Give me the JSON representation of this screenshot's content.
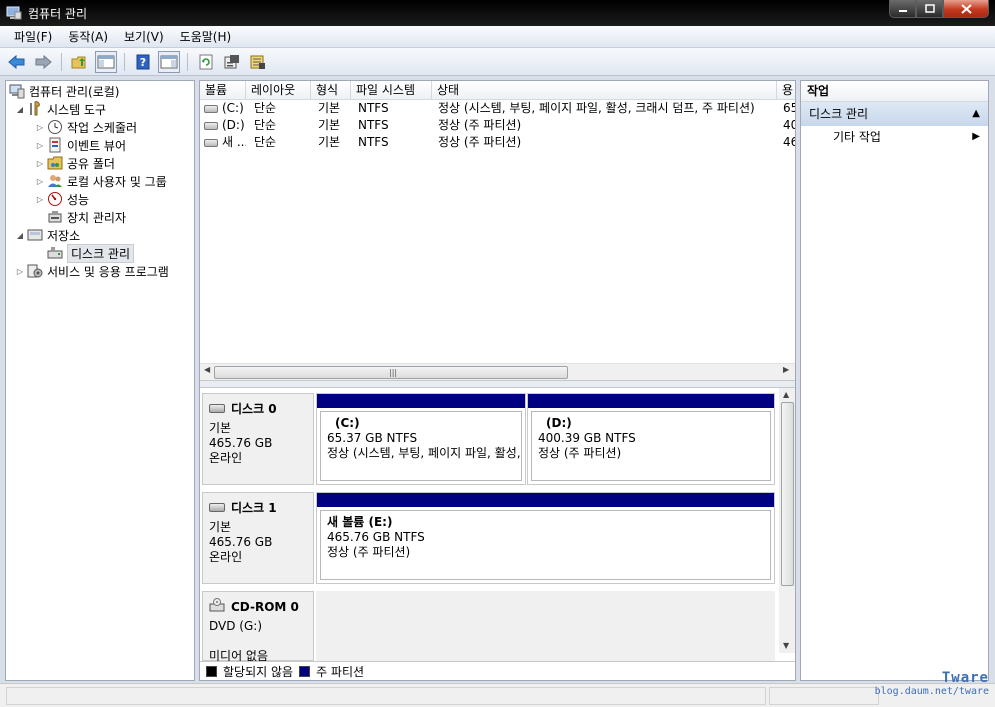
{
  "window": {
    "title": "컴퓨터 관리"
  },
  "menu": [
    "파일(F)",
    "동작(A)",
    "보기(V)",
    "도움말(H)"
  ],
  "toolbar": [
    "back-icon",
    "forward-icon",
    "up-folder-icon",
    "show-hide-tree-icon",
    "help-icon",
    "show-hide-action-pane-icon",
    "refresh-icon",
    "properties-icon",
    "export-icon"
  ],
  "tree": {
    "root": "컴퓨터 관리(로컬)",
    "system_tools": "시스템 도구",
    "task_scheduler": "작업 스케줄러",
    "event_viewer": "이벤트 뷰어",
    "shared_folders": "공유 폴더",
    "local_users": "로컬 사용자 및 그룹",
    "performance": "성능",
    "device_manager": "장치 관리자",
    "storage": "저장소",
    "disk_management": "디스크 관리",
    "services": "서비스 및 응용 프로그램"
  },
  "volume_list": {
    "columns": [
      "볼륨",
      "레이아웃",
      "형식",
      "파일 시스템",
      "상태",
      "용"
    ],
    "rows": [
      [
        "(C:)",
        "단순",
        "기본",
        "NTFS",
        "정상 (시스템, 부팅, 페이지 파일, 활성, 크래시 덤프, 주 파티션)",
        "65"
      ],
      [
        "(D:)",
        "단순",
        "기본",
        "NTFS",
        "정상 (주 파티션)",
        "40"
      ],
      [
        "새 ...",
        "단순",
        "기본",
        "NTFS",
        "정상 (주 파티션)",
        "46"
      ]
    ]
  },
  "disks": [
    {
      "name": "디스크 0",
      "type": "기본",
      "size": "465.76 GB",
      "status": "온라인",
      "partitions": [
        {
          "name": "(C:)",
          "size": "65.37 GB NTFS",
          "status": "정상 (시스템, 부팅, 페이지 파일, 활성, 크래시 덤프, 주 파티션)"
        },
        {
          "name": "(D:)",
          "size": "400.39 GB NTFS",
          "status": "정상 (주 파티션)"
        }
      ]
    },
    {
      "name": "디스크 1",
      "type": "기본",
      "size": "465.76 GB",
      "status": "온라인",
      "partitions": [
        {
          "name": "새 볼륨  (E:)",
          "size": "465.76 GB NTFS",
          "status": "정상 (주 파티션)"
        }
      ]
    }
  ],
  "cdrom": {
    "name": "CD-ROM 0",
    "drive": "DVD (G:)",
    "media": "미디어 없음"
  },
  "legend": [
    {
      "label": "할당되지 않음",
      "color": "#000000"
    },
    {
      "label": "주 파티션",
      "color": "#000080"
    }
  ],
  "actions": {
    "title": "작업",
    "section": "디스크 관리",
    "more": "기타 작업"
  },
  "watermark": {
    "brand": "Tware",
    "url": "blog.daum.net/tware"
  }
}
